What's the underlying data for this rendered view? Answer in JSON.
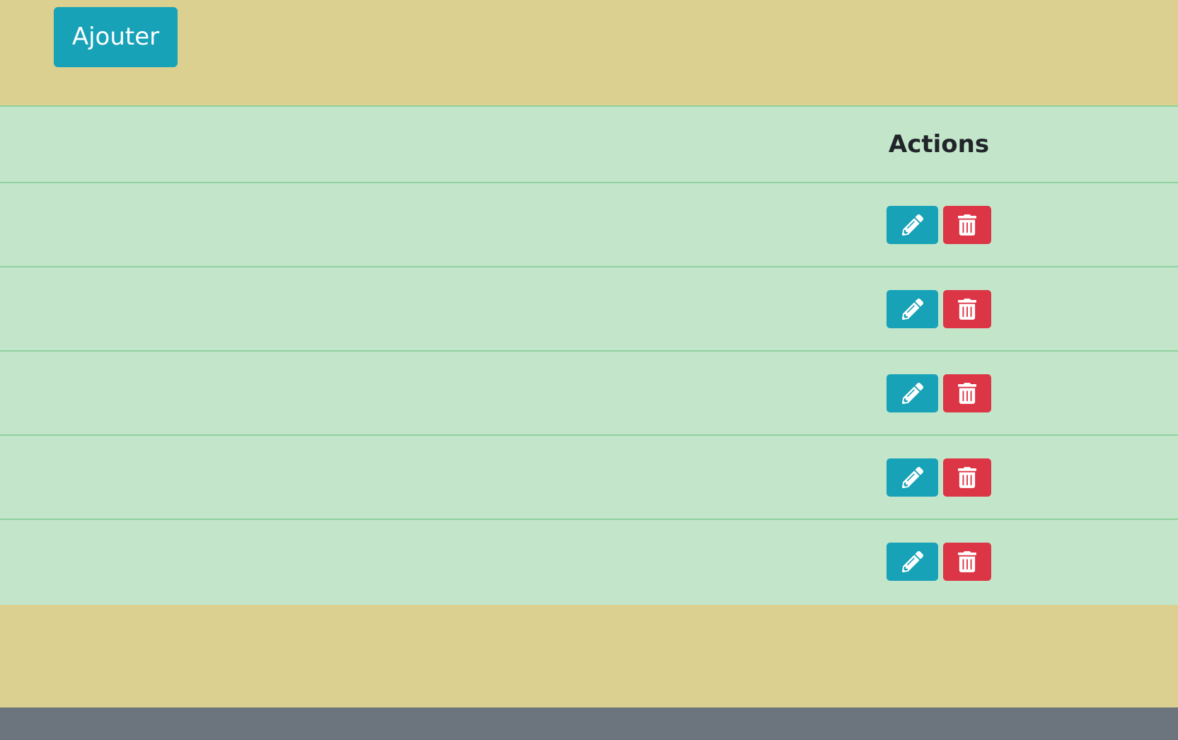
{
  "toolbar": {
    "add_label": "Ajouter"
  },
  "table": {
    "columns": [
      "",
      "Actions",
      ""
    ],
    "rows": [
      {
        "edit_icon": "pencil-icon",
        "delete_icon": "trash-icon"
      },
      {
        "edit_icon": "pencil-icon",
        "delete_icon": "trash-icon"
      },
      {
        "edit_icon": "pencil-icon",
        "delete_icon": "trash-icon"
      },
      {
        "edit_icon": "pencil-icon",
        "delete_icon": "trash-icon"
      },
      {
        "edit_icon": "pencil-icon",
        "delete_icon": "trash-icon"
      }
    ]
  },
  "colors": {
    "page_bg": "#dbd08f",
    "table_bg": "#c3e6cb",
    "table_border": "#8fd19e",
    "info": "#17a2b8",
    "danger": "#dc3545",
    "footer": "#6c757d"
  }
}
